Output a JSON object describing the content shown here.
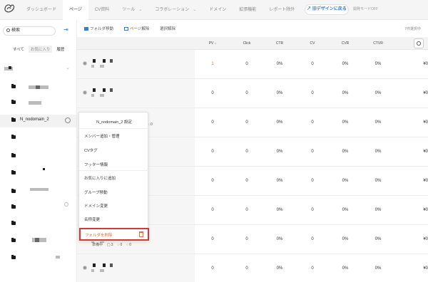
{
  "nav": {
    "items": [
      "ダッシュボード",
      "ページ",
      "CV資料",
      "ツール",
      "コラボレーション",
      "ドメイン",
      "拡張機能",
      "レポート除外"
    ],
    "design_button": "旧デザインに戻る",
    "dev_mode": "開発モードOFF"
  },
  "sidebar": {
    "search_label": "検索",
    "filters": [
      "すべて",
      "お気に入り",
      "履歴"
    ],
    "selected_folder": "N_nodomain_2"
  },
  "toolbar": {
    "move_folder": "フォルダ移動",
    "unlink_page": "ページ解除",
    "clear_selection": "選択解除",
    "count": "7件選択中"
  },
  "table": {
    "headers": [
      "PV ↓",
      "Click",
      "CTR",
      "CV",
      "CVR",
      "CTVR"
    ],
    "rows": [
      [
        "1",
        "0",
        "0%",
        "0",
        "0%",
        "0%",
        "¥0"
      ],
      [
        "0",
        "0",
        "0%",
        "0",
        "0%",
        "0%",
        "¥0"
      ],
      [
        "0",
        "0",
        "0%",
        "0",
        "0%",
        "0%",
        "¥0"
      ],
      [
        "0",
        "0",
        "0%",
        "0",
        "0%",
        "0%",
        "¥0"
      ],
      [
        "0",
        "0",
        "0%",
        "0",
        "0%",
        "0%",
        "¥0"
      ],
      [
        "0",
        "0",
        "0%",
        "0",
        "0%",
        "0%",
        "¥0"
      ],
      [
        "0",
        "0",
        "0%",
        "0",
        "0%",
        "0%",
        "¥0"
      ],
      [
        "0",
        "0",
        "0%",
        "0",
        "0%",
        "0%",
        "¥0"
      ]
    ]
  },
  "context_menu": {
    "title": "N_nodomain_2 設定",
    "items": [
      "メンバー追加・管理",
      "CVタグ",
      "フッター情報",
      "お気に入りに追加",
      "グループ移動",
      "ドメイン変更",
      "名称変更"
    ],
    "delete": "フォルダを削除"
  },
  "row_stats": {
    "status": "準備中",
    "count_a": "3",
    "count_b": "0",
    "count_c": "0",
    "row3_count": "0"
  },
  "colors": {
    "accent": "#2f7fd6",
    "pv": "#e0733a",
    "danger": "#d23a3a"
  }
}
